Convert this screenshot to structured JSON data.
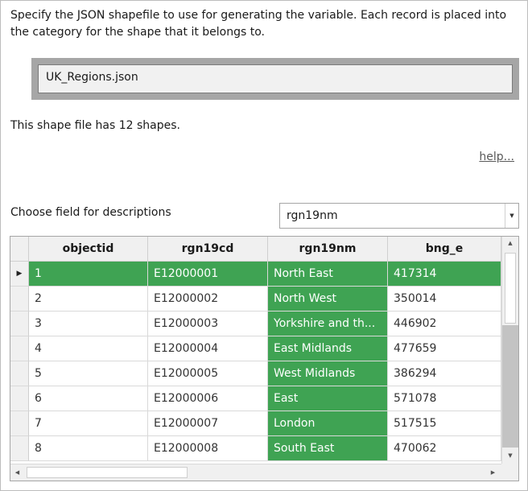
{
  "intro_text": "Specify the JSON shapefile to use for generating the variable. Each record is placed into the category for the shape that it belongs to.",
  "file": {
    "name": "UK_Regions.json"
  },
  "shape_count_text": "This shape file has 12 shapes.",
  "help_link": "help...",
  "description_field": {
    "label": "Choose field for descriptions",
    "selected": "rgn19nm"
  },
  "colors": {
    "highlight": "#3fa353"
  },
  "grid": {
    "columns": [
      "objectid",
      "rgn19cd",
      "rgn19nm",
      "bng_e"
    ],
    "rows": [
      {
        "objectid": "1",
        "rgn19cd": "E12000001",
        "rgn19nm": "North East",
        "bng_e": "417314"
      },
      {
        "objectid": "2",
        "rgn19cd": "E12000002",
        "rgn19nm": "North West",
        "bng_e": "350014"
      },
      {
        "objectid": "3",
        "rgn19cd": "E12000003",
        "rgn19nm": "Yorkshire and th...",
        "bng_e": "446902"
      },
      {
        "objectid": "4",
        "rgn19cd": "E12000004",
        "rgn19nm": "East Midlands",
        "bng_e": "477659"
      },
      {
        "objectid": "5",
        "rgn19cd": "E12000005",
        "rgn19nm": "West Midlands",
        "bng_e": "386294"
      },
      {
        "objectid": "6",
        "rgn19cd": "E12000006",
        "rgn19nm": "East",
        "bng_e": "571078"
      },
      {
        "objectid": "7",
        "rgn19cd": "E12000007",
        "rgn19nm": "London",
        "bng_e": "517515"
      },
      {
        "objectid": "8",
        "rgn19cd": "E12000008",
        "rgn19nm": "South East",
        "bng_e": "470062"
      }
    ]
  }
}
